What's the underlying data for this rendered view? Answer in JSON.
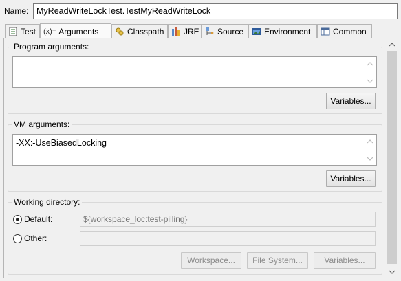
{
  "name": {
    "label": "Name:",
    "value": "MyReadWriteLockTest.TestMyReadWriteLock"
  },
  "tabs": [
    {
      "label": "Test",
      "icon": "test-icon"
    },
    {
      "label": "Arguments",
      "icon": "arguments-icon",
      "prefix": "(x)=",
      "active": true
    },
    {
      "label": "Classpath",
      "icon": "classpath-icon"
    },
    {
      "label": "JRE",
      "icon": "jre-icon"
    },
    {
      "label": "Source",
      "icon": "source-icon"
    },
    {
      "label": "Environment",
      "icon": "environment-icon"
    },
    {
      "label": "Common",
      "icon": "common-icon"
    }
  ],
  "program_args": {
    "label": "Program arguments:",
    "value": "",
    "variables_label": "Variables..."
  },
  "vm_args": {
    "label": "VM arguments:",
    "value": "-XX:-UseBiasedLocking",
    "variables_label": "Variables..."
  },
  "working_dir": {
    "label": "Working directory:",
    "default_label": "Default:",
    "default_value": "${workspace_loc:test-pilling}",
    "other_label": "Other:",
    "other_value": "",
    "workspace_label": "Workspace...",
    "filesystem_label": "File System...",
    "variables_label": "Variables..."
  },
  "colors": {
    "background": "#f0f0f0",
    "border": "#b5b5b5",
    "disabled_text": "#8c8c8c"
  }
}
